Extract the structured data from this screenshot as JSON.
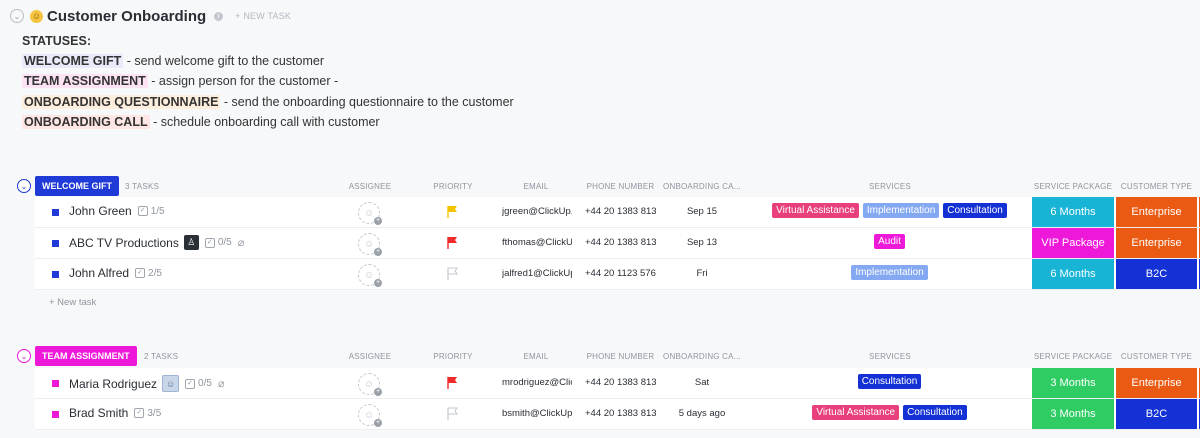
{
  "header": {
    "title": "Customer Onboarding",
    "new_task": "+ NEW TASK"
  },
  "statuses": {
    "heading": "STATUSES:",
    "items": [
      {
        "tag": "WELCOME GIFT",
        "text": " - send welcome gift to the customer"
      },
      {
        "tag": "TEAM ASSIGNMENT",
        "text": " - assign person for the customer -"
      },
      {
        "tag": "ONBOARDING QUESTIONNAIRE",
        "text": " - send the onboarding questionnaire to the customer"
      },
      {
        "tag": "ONBOARDING CALL",
        "text": " - schedule onboarding call with customer"
      }
    ]
  },
  "columns": {
    "assignee": "ASSIGNEE",
    "priority": "PRIORITY",
    "email": "EMAIL",
    "phone": "PHONE NUMBER",
    "onboarding": "ONBOARDING CA...",
    "services": "SERVICES",
    "package": "SERVICE PACKAGE",
    "ctype": "CUSTOMER TYPE"
  },
  "groups": [
    {
      "name": "WELCOME GIFT",
      "count": "3 TASKS",
      "color": "#1f3ad6",
      "new_task": "+ New task",
      "tasks": [
        {
          "name": "John Green",
          "sub": "1/5",
          "email": "jgreen@ClickUp.",
          "phone": "+44 20 1383 813",
          "onb": "Sep 15",
          "services": [
            {
              "label": "Virtual Assistance",
              "color": "#e7407c"
            },
            {
              "label": "Implementation",
              "color": "#84a9f2"
            },
            {
              "label": "Consultation",
              "color": "#1331d4"
            }
          ],
          "package": {
            "label": "6 Months",
            "color": "#18b4d6"
          },
          "ctype": {
            "label": "Enterprise",
            "color": "#ea5a12"
          },
          "edge_color": "#ea5a12",
          "priority": "#f5c400"
        },
        {
          "name": "ABC TV Productions",
          "sub": "0/5",
          "email": "fthomas@ClickUp",
          "phone": "+44 20 1383 813",
          "onb": "Sep 13",
          "services": [
            {
              "label": "Audit",
              "color": "#ee18d9"
            }
          ],
          "package": {
            "label": "VIP Package",
            "color": "#ee18d9"
          },
          "ctype": {
            "label": "Enterprise",
            "color": "#ea5a12"
          },
          "edge_color": "#ea5a12",
          "priority": "#ef2a2a"
        },
        {
          "name": "John Alfred",
          "sub": "2/5",
          "email": "jalfred1@ClickUp",
          "phone": "+44 20 1123 576",
          "onb": "Fri",
          "services": [
            {
              "label": "Implementation",
              "color": "#84a9f2"
            }
          ],
          "package": {
            "label": "6 Months",
            "color": "#18b4d6"
          },
          "ctype": {
            "label": "B2C",
            "color": "#1331d4"
          },
          "edge_color": "#1331d4",
          "priority": "none"
        }
      ]
    },
    {
      "name": "TEAM ASSIGNMENT",
      "count": "2 TASKS",
      "color": "#ee18d9",
      "tasks": [
        {
          "name": "Maria Rodriguez",
          "sub": "0/5",
          "email": "mrodriguez@Clic",
          "phone": "+44 20 1383 813",
          "onb": "Sat",
          "services": [
            {
              "label": "Consultation",
              "color": "#1331d4"
            }
          ],
          "package": {
            "label": "3 Months",
            "color": "#2ecc63"
          },
          "ctype": {
            "label": "Enterprise",
            "color": "#ea5a12"
          },
          "edge_color": "#ea5a12",
          "priority": "#ef2a2a"
        },
        {
          "name": "Brad Smith",
          "sub": "3/5",
          "email": "bsmith@ClickUp.",
          "phone": "+44 20 1383 813",
          "onb": "5 days ago",
          "services": [
            {
              "label": "Virtual Assistance",
              "color": "#e7407c"
            },
            {
              "label": "Consultation",
              "color": "#1331d4"
            }
          ],
          "package": {
            "label": "3 Months",
            "color": "#2ecc63"
          },
          "ctype": {
            "label": "B2C",
            "color": "#1331d4"
          },
          "edge_color": "#1331d4",
          "priority": "none"
        }
      ]
    }
  ],
  "icons": {
    "collapse": "chevron-down-icon",
    "info": "info-icon",
    "subtask": "checkbox-icon",
    "attachment": "paperclip-icon",
    "assignee": "add-assignee-icon",
    "priority": "flag-icon"
  }
}
